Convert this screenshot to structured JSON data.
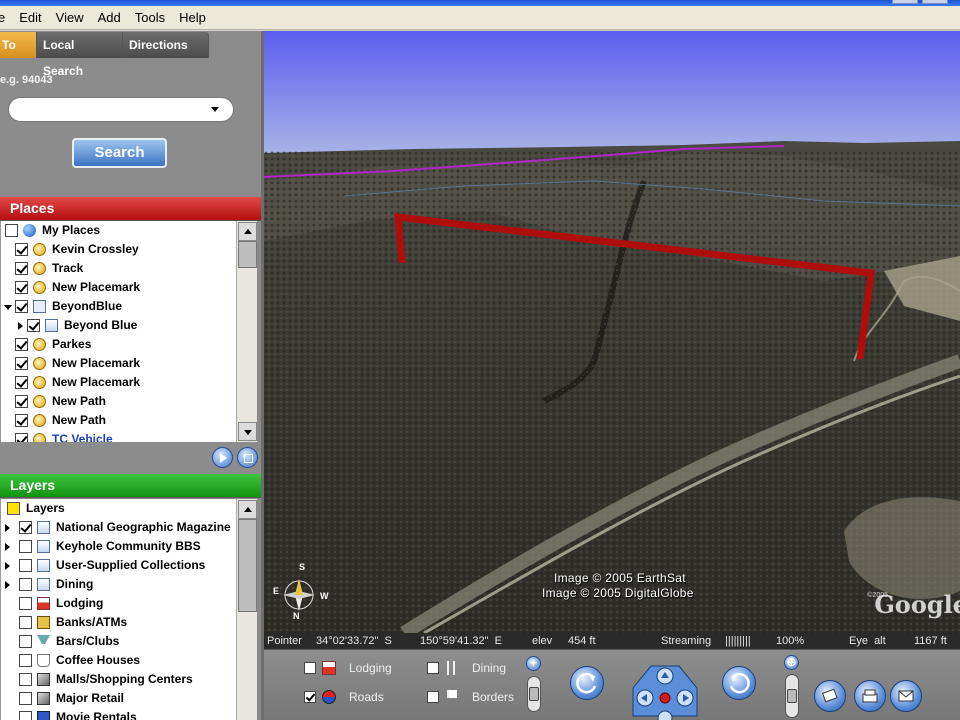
{
  "menu": {
    "items": [
      "e",
      "Edit",
      "View",
      "Add",
      "Tools",
      "Help"
    ]
  },
  "search": {
    "tabs": [
      "y To",
      "Local Search",
      "Directions"
    ],
    "hint": "e.g. 94043",
    "input_value": "",
    "button_label": "Search"
  },
  "places": {
    "title": "Places",
    "items": [
      {
        "label": "My Places",
        "checked": false,
        "icon": "globe-icon",
        "indent": 0
      },
      {
        "label": "Kevin Crossley",
        "checked": true,
        "icon": "placemark-icon",
        "indent": 1
      },
      {
        "label": "Track",
        "checked": true,
        "icon": "placemark-icon",
        "indent": 1
      },
      {
        "label": "New Placemark",
        "checked": true,
        "icon": "placemark-icon",
        "indent": 1
      },
      {
        "label": "BeyondBlue",
        "checked": true,
        "icon": "document-icon",
        "indent": 1,
        "expanded": true
      },
      {
        "label": "Beyond Blue",
        "checked": true,
        "icon": "folder-icon",
        "indent": 2,
        "collapsed": true
      },
      {
        "label": "Parkes",
        "checked": true,
        "icon": "placemark-icon",
        "indent": 1
      },
      {
        "label": "New Placemark",
        "checked": true,
        "icon": "placemark-icon",
        "indent": 1
      },
      {
        "label": "New Placemark",
        "checked": true,
        "icon": "placemark-icon",
        "indent": 1
      },
      {
        "label": "New Path",
        "checked": true,
        "icon": "placemark-icon",
        "indent": 1
      },
      {
        "label": "New Path",
        "checked": true,
        "icon": "placemark-icon",
        "indent": 1
      },
      {
        "label": "TC Vehicle",
        "checked": true,
        "icon": "placemark-icon",
        "indent": 1
      }
    ]
  },
  "layers": {
    "title": "Layers",
    "items": [
      {
        "label": "Layers",
        "checked": null,
        "icon": "layers-icon",
        "indent": 0
      },
      {
        "label": "National Geographic Magazine",
        "checked": true,
        "icon": "folder-icon",
        "expander": true
      },
      {
        "label": "Keyhole Community BBS",
        "checked": false,
        "icon": "folder-icon",
        "expander": true
      },
      {
        "label": "User-Supplied Collections",
        "checked": false,
        "icon": "folder-icon",
        "expander": true
      },
      {
        "label": "Dining",
        "checked": false,
        "icon": "folder-icon",
        "expander": true
      },
      {
        "label": "Lodging",
        "checked": false,
        "icon": "lodging-icon",
        "expander": false
      },
      {
        "label": "Banks/ATMs",
        "checked": false,
        "icon": "bank-icon",
        "expander": false
      },
      {
        "label": "Bars/Clubs",
        "checked": false,
        "icon": "glass-icon",
        "expander": false
      },
      {
        "label": "Coffee Houses",
        "checked": false,
        "icon": "cup-icon",
        "expander": false
      },
      {
        "label": "Malls/Shopping Centers",
        "checked": false,
        "icon": "cube-icon",
        "expander": false
      },
      {
        "label": "Major Retail",
        "checked": false,
        "icon": "cube-icon",
        "expander": false
      },
      {
        "label": "Movie Rentals",
        "checked": false,
        "icon": "film-icon",
        "expander": false
      }
    ]
  },
  "view": {
    "attribution_1": "Image © 2005 EarthSat",
    "attribution_2": "Image © 2005 DigitalGlobe",
    "logo": "Google",
    "tiny_copyright": "©2005",
    "compass_n": "N",
    "compass_s": "S",
    "compass_e": "E",
    "compass_w": "W"
  },
  "status": {
    "pointer_label": "Pointer",
    "lat": "34°02'33.72\"  S",
    "lon": "150°59'41.32\"  E",
    "elev_label": "elev",
    "elev": "454 ft",
    "streaming_label": "Streaming",
    "streaming_bars": "|||||||||",
    "streaming_pct": "100%",
    "eye_label": "Eye  alt",
    "eye_alt": "1167 ft"
  },
  "controls": {
    "options": [
      {
        "label": "Lodging",
        "checked": false,
        "icon": "lodging-icon"
      },
      {
        "label": "Roads",
        "checked": true,
        "icon": "roads-icon"
      },
      {
        "label": "Dining",
        "checked": false,
        "icon": "dining-icon"
      },
      {
        "label": "Borders",
        "checked": false,
        "icon": "flag-icon"
      }
    ],
    "zoom_in": "+"
  },
  "colors": {
    "places_header": "#c31616",
    "layers_header": "#18a018",
    "path_line": "#b00d0d",
    "search_button": "#3d74c4"
  }
}
